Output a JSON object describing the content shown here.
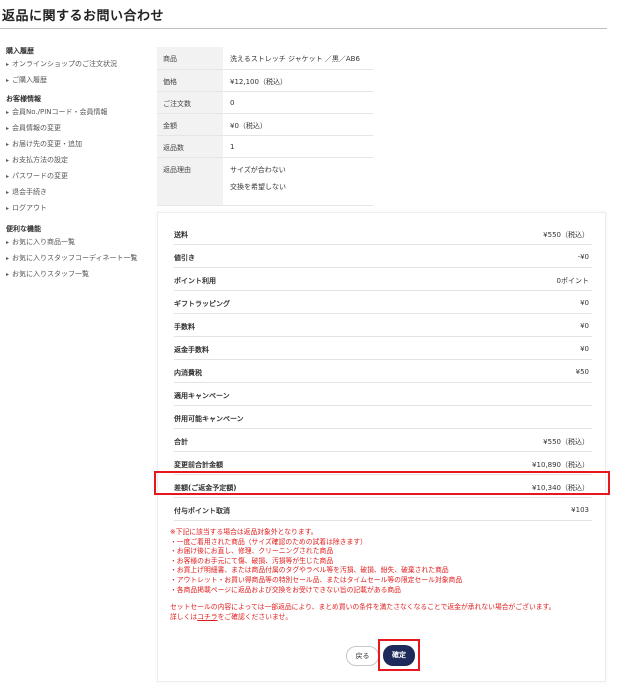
{
  "page": {
    "title": "返品に関するお問い合わせ"
  },
  "sidebar": {
    "sections": [
      {
        "heading": "購入履歴",
        "items": [
          "オンラインショップのご注文状況",
          "ご購入履歴"
        ]
      },
      {
        "heading": "お客様情報",
        "items": [
          "会員No./PINコード・会員情報",
          "会員情報の変更",
          "お届け先の変更・追加",
          "お支払方法の設定",
          "パスワードの変更",
          "退会手続き",
          "ログアウト"
        ]
      },
      {
        "heading": "便利な機能",
        "items": [
          "お気に入り商品一覧",
          "お気に入りスタッフコーディネート一覧",
          "お気に入りスタッフ一覧"
        ]
      }
    ]
  },
  "product": {
    "rows": [
      {
        "label": "商品",
        "value": "洗えるストレッチ ジャケット ／黒／AB6"
      },
      {
        "label": "価格",
        "value": "¥12,100（税込）"
      },
      {
        "label": "ご注文数",
        "value": "0"
      },
      {
        "label": "金額",
        "value": "¥0（税込）"
      },
      {
        "label": "返品数",
        "value": "1"
      }
    ],
    "reason": {
      "label": "返品理由",
      "values": [
        "サイズが合わない",
        "交換を希望しない"
      ]
    }
  },
  "summary": {
    "rows": [
      {
        "label": "送料",
        "value": "¥550（税込）"
      },
      {
        "label": "値引き",
        "value": "-¥0"
      },
      {
        "label": "ポイント利用",
        "value": "0ポイント"
      },
      {
        "label": "ギフトラッピング",
        "value": "¥0"
      },
      {
        "label": "手数料",
        "value": "¥0"
      },
      {
        "label": "返金手数料",
        "value": "¥0"
      },
      {
        "label": "内消費税",
        "value": "¥50"
      },
      {
        "label": "適用キャンペーン",
        "value": ""
      },
      {
        "label": "併用可能キャンペーン",
        "value": ""
      },
      {
        "label": "合計",
        "value": "¥550（税込）"
      },
      {
        "label": "変更前合計金額",
        "value": "¥10,890（税込）"
      },
      {
        "label": "差額(ご返金予定額)",
        "value": "¥10,340（税込）"
      },
      {
        "label": "付与ポイント取消",
        "value": "¥103"
      }
    ]
  },
  "notes": {
    "lines": [
      "※下記に該当する場合は返品対象外となります。",
      "・一度ご着用された商品（サイズ確認のための試着は除きます）",
      "・お届け後にお直し、修理、クリーニングされた商品",
      "・お客様のお手元にて傷、破損、汚損等が生じた商品",
      "・お買上げ明細書、または商品付属のタグやラベル等を汚損、破損、紛失、破棄された商品",
      "・アウトレット・お買い得商品等の特別セール品、またはタイムセール等の限定セール対象商品",
      "・各商品掲載ページに返品および交換をお受けできない旨の記載がある商品"
    ],
    "footer_line1": "セットセールの内容によっては一部返品により、まとめ買いの条件を満たさなくなることで返金が承れない場合がございます。",
    "footer_prefix": "詳しくは",
    "footer_link": "コチラ",
    "footer_suffix": "をご確認くださいませ。"
  },
  "buttons": {
    "back": "戻る",
    "confirm": "確定"
  },
  "colors": {
    "accent": "#e8171d",
    "primary_button": "#1e2a5a",
    "note_text": "#e11c1c"
  }
}
